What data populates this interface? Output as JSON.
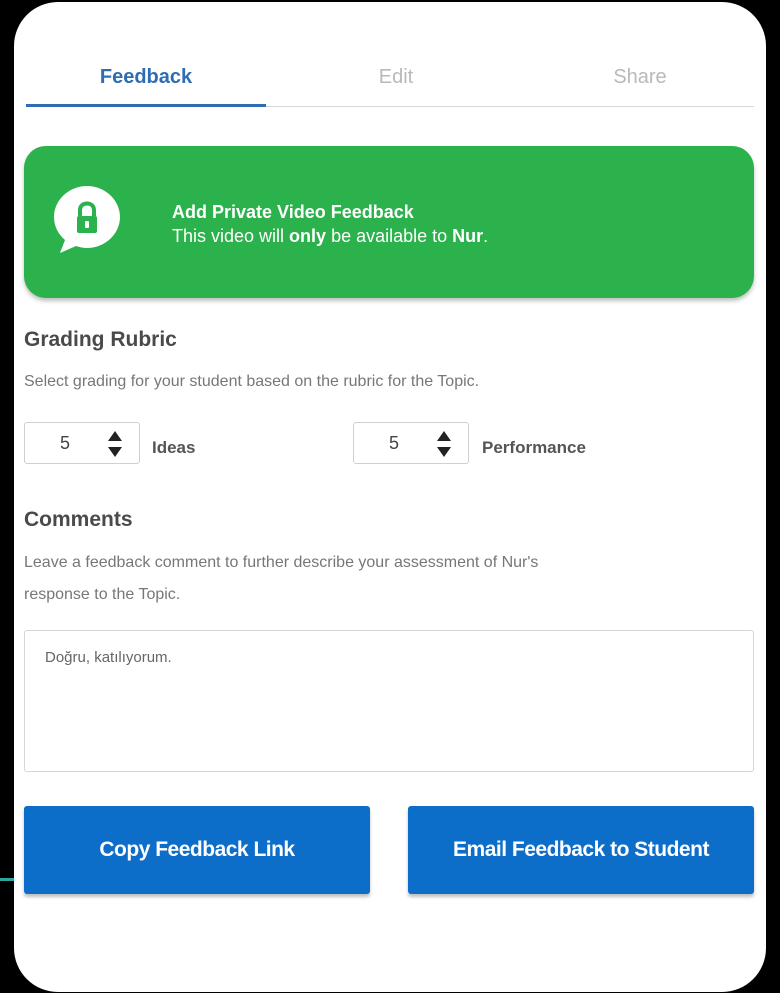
{
  "tabs": [
    {
      "label": "Feedback",
      "active": true
    },
    {
      "label": "Edit",
      "active": false
    },
    {
      "label": "Share",
      "active": false
    }
  ],
  "banner": {
    "icon": "lock-icon",
    "title": "Add Private Video Feedback",
    "subtitle_prefix": "This video will ",
    "subtitle_emph": "only",
    "subtitle_mid": " be available to ",
    "student_name": "Nur",
    "subtitle_end": ".",
    "color": "#2bb24c"
  },
  "rubric": {
    "heading": "Grading Rubric",
    "description": "Select grading for your student based on the rubric for the Topic.",
    "criteria": [
      {
        "value": "5",
        "label": "Ideas"
      },
      {
        "value": "5",
        "label": "Performance"
      }
    ]
  },
  "comments": {
    "heading": "Comments",
    "description_line1": "Leave a feedback comment to further describe your assessment of Nur's",
    "description_line2": "response to the Topic.",
    "value": "Doğru, katılıyorum."
  },
  "actions": {
    "copy_label": "Copy Feedback Link",
    "email_label": "Email Feedback to Student",
    "color": "#0d6ec9"
  }
}
